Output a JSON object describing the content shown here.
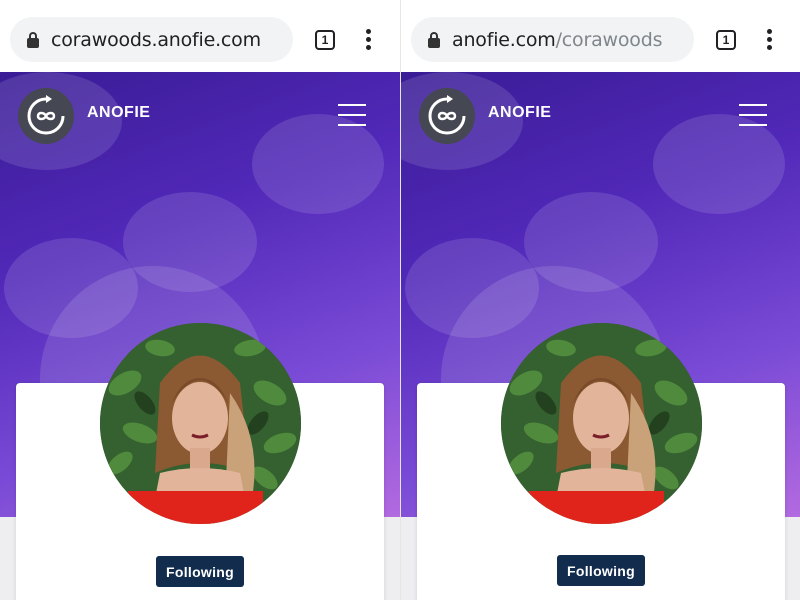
{
  "screens": [
    {
      "url_host": "corawoods.anofie.com",
      "url_path": "",
      "tab_count": "1",
      "brand": "ANOFIE",
      "follow_label": "Following"
    },
    {
      "url_host": "anofie.com",
      "url_path": "/corawoods",
      "tab_count": "1",
      "brand": "ANOFIE",
      "follow_label": "Following"
    }
  ],
  "colors": {
    "hero_top": "#3a1c96",
    "hero_bottom": "#b36ae0",
    "button": "#122c4e",
    "logo_bg": "#454852"
  },
  "icons": [
    "lock-icon",
    "tab-switcher-icon",
    "more-vert-icon",
    "infinity-refresh-logo",
    "hamburger-menu-icon"
  ]
}
